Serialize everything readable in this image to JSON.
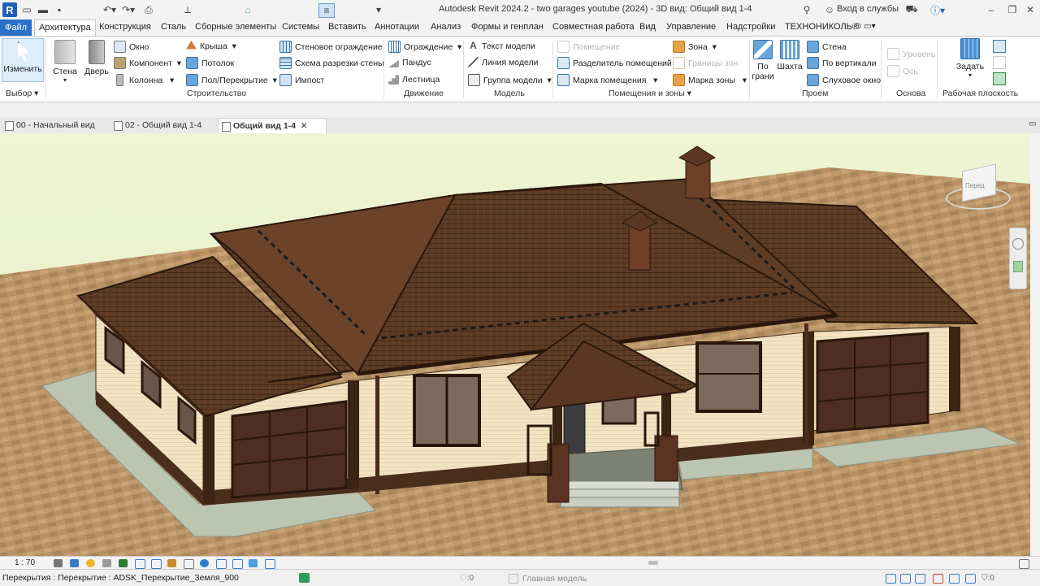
{
  "title": "Autodesk Revit 2024.2 - two garages youtube (2024) - 3D вид: Общий вид 1-4",
  "login": "Вход в службы",
  "menu_tabs": [
    "Файл",
    "Архитектура",
    "Конструкция",
    "Сталь",
    "Сборные элементы",
    "Системы",
    "Вставить",
    "Аннотации",
    "Анализ",
    "Формы и генплан",
    "Совместная работа",
    "Вид",
    "Управление",
    "Надстройки",
    "ТЕХНОНИКОЛЬ®"
  ],
  "ribbon": {
    "modify": "Изменить",
    "select": "Выбор",
    "wall": "Стена",
    "door": "Дверь",
    "window": "Окно",
    "component": "Компонент",
    "column": "Колонна",
    "roof": "Крыша",
    "ceiling": "Потолок",
    "floor": "Пол/Перекрытие",
    "curtain_system": "Стеновое ограждение",
    "curtain_grid": "Схема разрезки стены",
    "mullion": "Импост",
    "build_panel": "Строительство",
    "railing": "Ограждение",
    "ramp": "Пандус",
    "stair": "Лестница",
    "circulation_panel": "Движение",
    "model_text": "Текст модели",
    "model_line": "Линия модели",
    "model_group": "Группа модели",
    "model_panel": "Модель",
    "room": "Помещение",
    "room_separator": "Разделитель помещений",
    "room_tag": "Марка помещения",
    "area": "Зона",
    "area_boundary": "Границы зон",
    "area_tag": "Марка зоны",
    "rooms_panel": "Помещения и зоны",
    "by_face": "По грани",
    "shaft": "Шахта",
    "opening_wall": "Стена",
    "vertical": "По вертикали",
    "dormer": "Слуховое окно",
    "opening_panel": "Проем",
    "level": "Уровень",
    "grid": "Ось",
    "datum_panel": "Основа",
    "set": "Задать",
    "workplane_panel": "Рабочая плоскость"
  },
  "doc_tabs": [
    "00 - Начальный вид",
    "02 - Общий вид 1-4",
    "Общий вид 1-4"
  ],
  "viewcube_label": "Перед",
  "scale": "1 : 70",
  "status": "Перекрытия : Перекрытие : ADSK_Перекрытие_Земля_900",
  "status_zero": ":0",
  "main_model": "Главная модель",
  "filter_count": ":0"
}
